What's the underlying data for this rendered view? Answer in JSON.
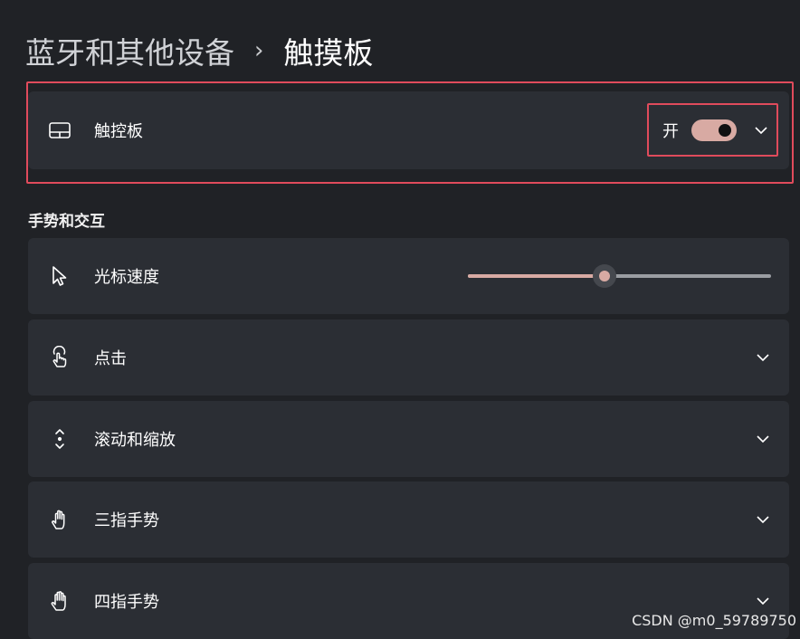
{
  "breadcrumb": {
    "parent": "蓝牙和其他设备",
    "separator": "›",
    "current": "触摸板"
  },
  "touchpad": {
    "icon": "touchpad-icon",
    "label": "触控板",
    "state_label": "开",
    "enabled": true
  },
  "section": {
    "title": "手势和交互"
  },
  "rows": [
    {
      "icon": "cursor-icon",
      "label": "光标速度"
    },
    {
      "icon": "tap-icon",
      "label": "点击"
    },
    {
      "icon": "scroll-icon",
      "label": "滚动和缩放"
    },
    {
      "icon": "three-finger-icon",
      "label": "三指手势"
    },
    {
      "icon": "four-finger-icon",
      "label": "四指手势"
    }
  ],
  "cursor_speed": {
    "level_fraction": 0.45
  },
  "watermark": "CSDN @m0_59789750",
  "colors": {
    "accent": "#d8aaa3",
    "highlight_border": "#e04b5c",
    "card_bg": "#2b2e34",
    "page_bg": "#202226"
  }
}
